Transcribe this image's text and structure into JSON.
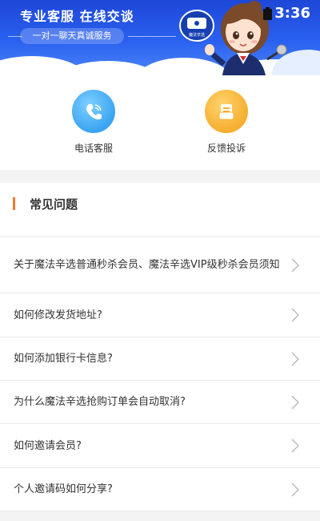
{
  "header": {
    "title": "专业客服 在线交谈",
    "subtitle": "一对一聊天真诚服务",
    "badge_text": "魔法辛选",
    "mascot": "customer-service-girl-illustration"
  },
  "status_bar": {
    "time": "3:36"
  },
  "services": [
    {
      "label": "电话客服",
      "icon": "phone-icon",
      "color": "#3aa4f2"
    },
    {
      "label": "反馈投诉",
      "icon": "feedback-icon",
      "color": "#f6ae2f"
    }
  ],
  "faq": {
    "title": "常见问题",
    "accent_color": "#f07a2a",
    "items": [
      {
        "question": "关于魔法辛选普通秒杀会员、魔法辛选VIP级秒杀会员须知"
      },
      {
        "question": "如何修改发货地址?"
      },
      {
        "question": "如何添加银行卡信息?"
      },
      {
        "question": "为什么魔法辛选抢购订单会自动取消?"
      },
      {
        "question": "如何邀请会员?"
      },
      {
        "question": "个人邀请码如何分享?"
      }
    ]
  }
}
